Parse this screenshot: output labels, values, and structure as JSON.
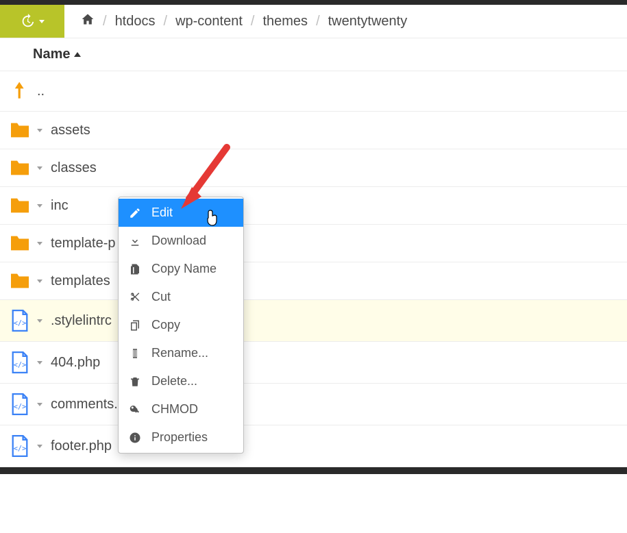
{
  "breadcrumbs": {
    "items": [
      "htdocs",
      "wp-content",
      "themes",
      "twentytwenty"
    ]
  },
  "table": {
    "name_header": "Name"
  },
  "rows": {
    "up": "..",
    "f0": "assets",
    "f1": "classes",
    "f2": "inc",
    "f3": "template-p",
    "f4": "templates",
    "file0": ".stylelintrc",
    "file1": "404.php",
    "file2": "comments.php",
    "file3": "footer.php"
  },
  "contextMenu": {
    "edit": "Edit",
    "download": "Download",
    "copyName": "Copy Name",
    "cut": "Cut",
    "copy": "Copy",
    "rename": "Rename...",
    "delete": "Delete...",
    "chmod": "CHMOD",
    "properties": "Properties"
  }
}
